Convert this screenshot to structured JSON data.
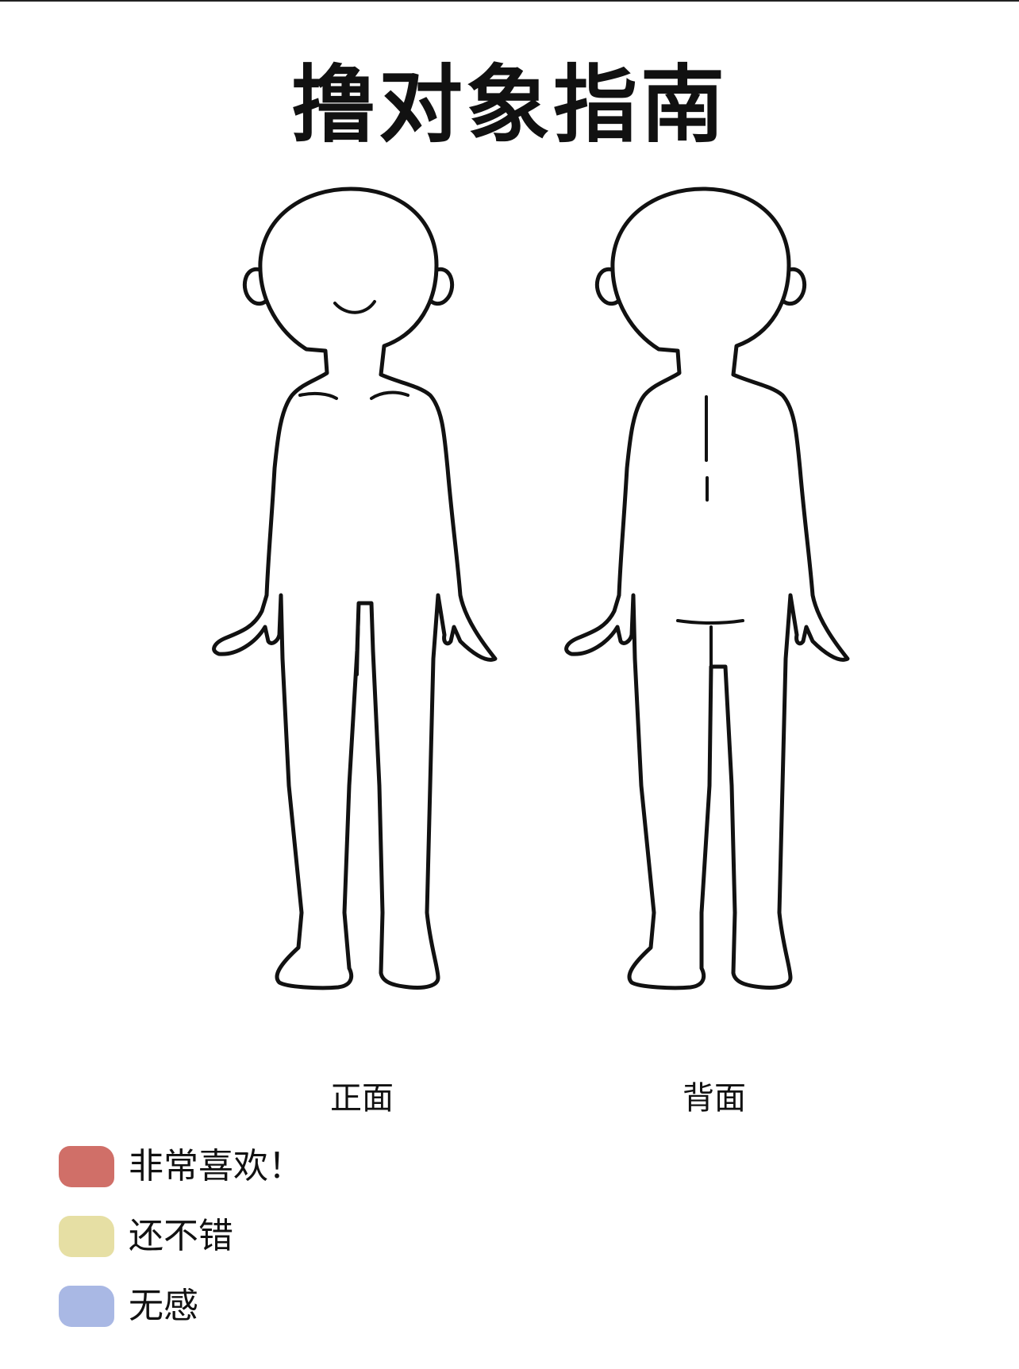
{
  "title": "撸对象指南",
  "figures": {
    "front": {
      "label": "正面"
    },
    "back": {
      "label": "背面"
    }
  },
  "legend": [
    {
      "label": "非常喜欢！",
      "color": "#d06f68"
    },
    {
      "label": "还不错",
      "color": "#e6dfa4"
    },
    {
      "label": "无感",
      "color": "#a9b8e4"
    }
  ],
  "colors": {
    "outline": "#111111",
    "background": "#ffffff"
  }
}
